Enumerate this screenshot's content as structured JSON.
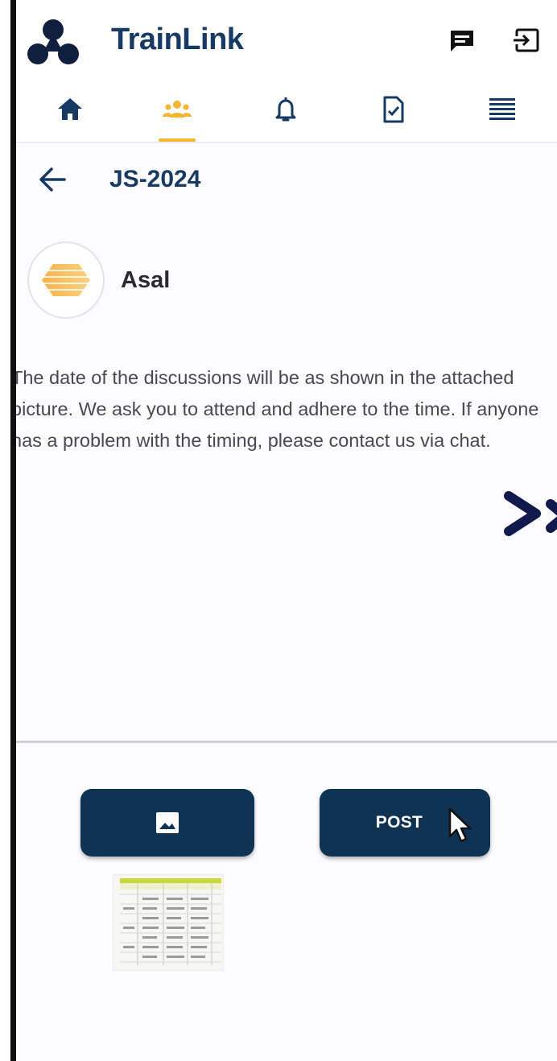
{
  "app": {
    "title": "TrainLink"
  },
  "topbar": {
    "actions": [
      {
        "name": "chat-icon"
      },
      {
        "name": "logout-icon"
      }
    ]
  },
  "nav": {
    "tabs": [
      {
        "icon": "home-icon",
        "active": false
      },
      {
        "icon": "groups-icon",
        "active": true
      },
      {
        "icon": "bell-icon",
        "active": false
      },
      {
        "icon": "task-check-icon",
        "active": false
      },
      {
        "icon": "menu-icon",
        "active": false
      }
    ],
    "active_color": "#f4b531",
    "inactive_color": "#163a63"
  },
  "header": {
    "back_icon": "arrow-left-icon",
    "group_title": "JS-2024"
  },
  "post": {
    "author": "Asal",
    "body": "The date of the discussions will be as shown in the attached picture. We ask you to attend and adhere to the time. If anyone has a problem with the timing, please contact us via chat."
  },
  "actions": {
    "image_icon": "image-icon",
    "post_label": "POST"
  },
  "colors": {
    "brand_navy": "#163a63",
    "button_navy": "#0f3352",
    "accent_yellow": "#f4b531",
    "background": "#fcfbfd"
  }
}
